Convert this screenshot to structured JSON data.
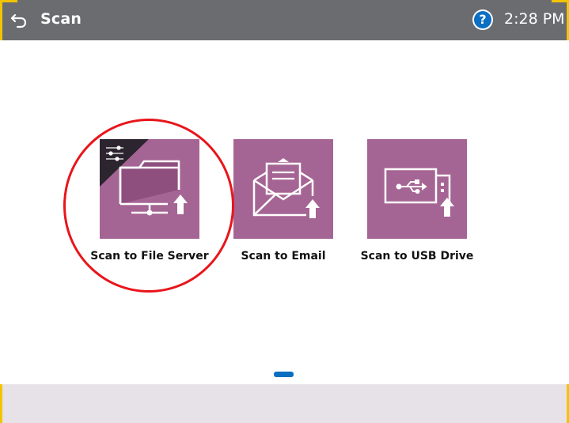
{
  "header": {
    "title": "Scan",
    "time": "2:28 PM",
    "help_label": "?"
  },
  "tiles": [
    {
      "label": "Scan to File Server",
      "icon": "folder-network-icon"
    },
    {
      "label": "Scan to Email",
      "icon": "envelope-icon"
    },
    {
      "label": "Scan to USB Drive",
      "icon": "usb-drive-icon"
    }
  ],
  "pager": {
    "active_page": 1
  },
  "colors": {
    "header_bg": "#6b6c70",
    "tile_bg": "#a56594",
    "accent_blue": "#0b6fc2",
    "highlight_ring": "#e8151b",
    "corner_yellow": "#f2c400",
    "footer_bg": "#e7e2e7"
  }
}
